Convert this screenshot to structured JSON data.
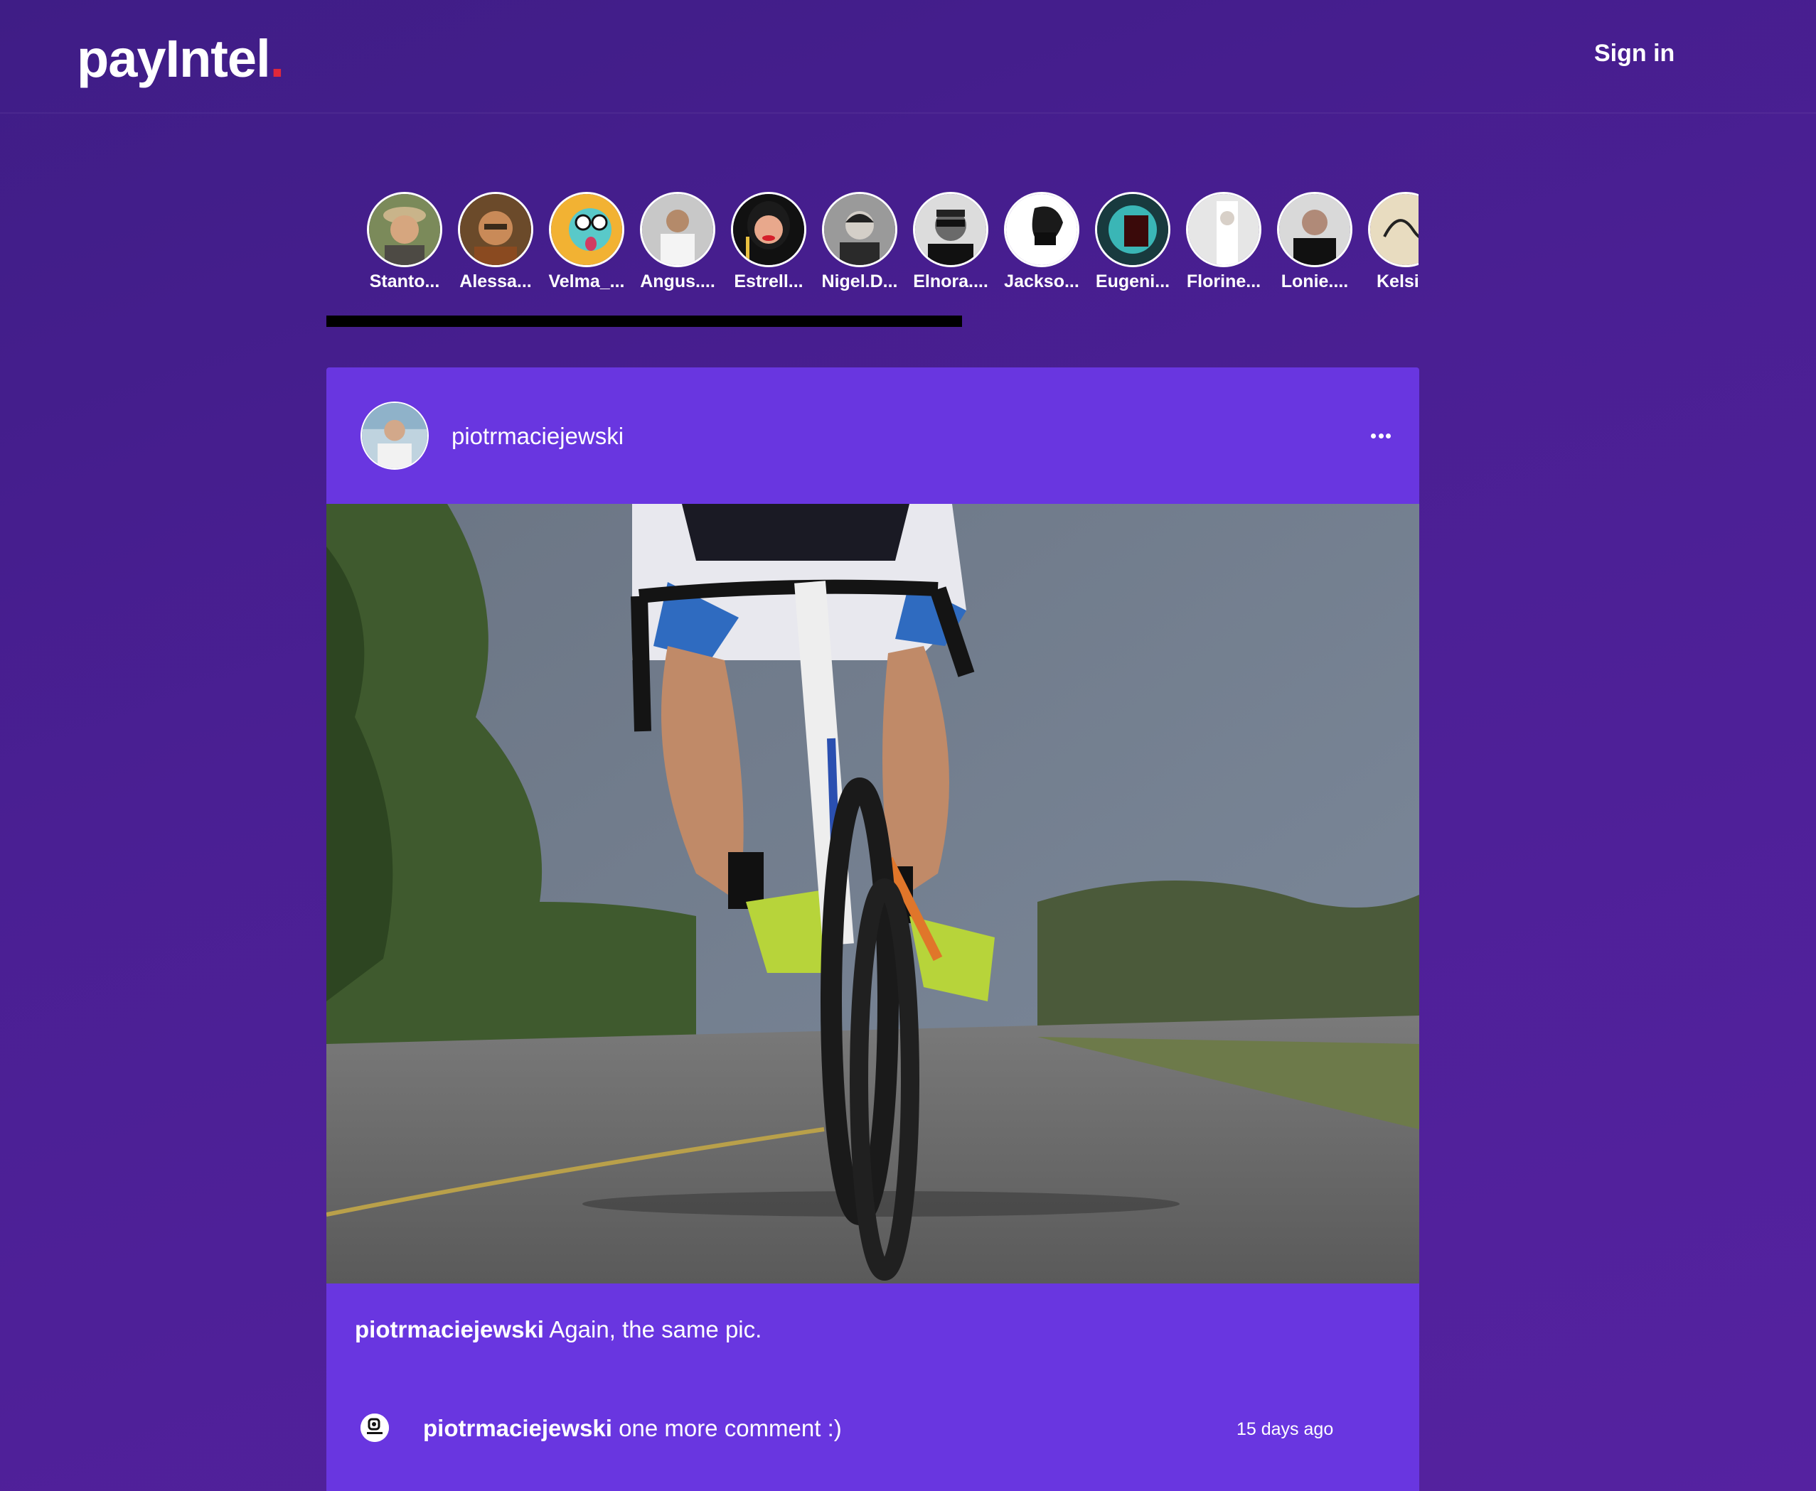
{
  "header": {
    "logo_text": "payIntel",
    "logo_dot": ".",
    "signin_label": "Sign in"
  },
  "stories": [
    {
      "name": "Stanto..."
    },
    {
      "name": "Alessa..."
    },
    {
      "name": "Velma_..."
    },
    {
      "name": "Angus...."
    },
    {
      "name": "Estrell..."
    },
    {
      "name": "Nigel.D..."
    },
    {
      "name": "Elnora...."
    },
    {
      "name": "Jackso..."
    },
    {
      "name": "Eugeni..."
    },
    {
      "name": "Florine..."
    },
    {
      "name": "Lonie...."
    },
    {
      "name": "Kelsi.F"
    }
  ],
  "post": {
    "author": "piotrmaciejewski",
    "caption_author": "piotrmaciejewski",
    "caption_text": "Again, the same pic.",
    "comments": [
      {
        "author": "piotrmaciejewski",
        "text": "one more comment :)",
        "time": "15 days ago"
      }
    ]
  },
  "colors": {
    "background": "#4a1f93",
    "card": "#6936e0",
    "logo_dot": "#e0283a",
    "scrollbar": "#000000"
  }
}
